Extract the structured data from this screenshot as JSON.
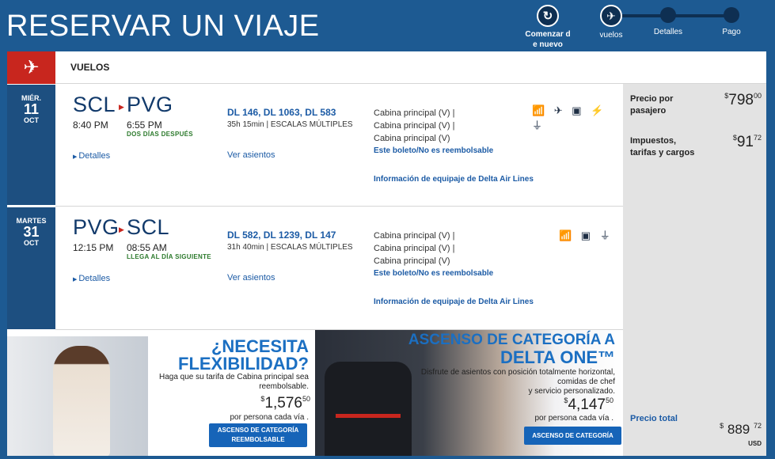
{
  "header": {
    "title": "RESERVAR UN VIAJE",
    "restart_label_1": "Comenzar d",
    "restart_label_2": "e nuevo",
    "steps": [
      {
        "label": "vuelos"
      },
      {
        "label": "Detalles"
      },
      {
        "label": "Pago"
      }
    ]
  },
  "section": {
    "title": "VUELOS"
  },
  "flights": [
    {
      "date_weekday": "MIÉR.",
      "date_day": "11",
      "date_month": "OCT",
      "origin": "SCL",
      "destination": "PVG",
      "depart_time": "8:40 PM",
      "arrive_time": "6:55 PM",
      "arrive_note": "DOS DÍAS DESPUÉS",
      "details_link": "Detalles",
      "flight_numbers": "DL 146, DL 1063, DL 583",
      "duration": "35h 15min",
      "stops": "ESCALAS MÚLTIPLES",
      "seats_link": "Ver asientos",
      "cabins": [
        "Cabina principal (V) |",
        "Cabina principal (V) |",
        "Cabina principal (V)"
      ],
      "refund": "Este boleto/No es reembolsable",
      "baggage": "Información de equipaje de Delta Air Lines",
      "amenities": "📶 ✈ ▣ ⚡ ⏚"
    },
    {
      "date_weekday": "MARTES",
      "date_day": "31",
      "date_month": "OCT",
      "origin": "PVG",
      "destination": "SCL",
      "depart_time": "12:15 PM",
      "arrive_time": "08:55 AM",
      "arrive_note": "LLEGA AL DÍA SIGUIENTE",
      "details_link": "Detalles",
      "flight_numbers": "DL 582, DL 1239, DL 147",
      "duration": "31h 40min",
      "stops": "ESCALAS MÚLTIPLES",
      "seats_link": "Ver asientos",
      "cabins": [
        "Cabina principal (V) |",
        "Cabina principal (V) |",
        "Cabina principal (V)"
      ],
      "refund": "Este boleto/No es reembolsable",
      "baggage": "Información de equipaje de Delta Air Lines",
      "amenities": "📶 ▣ ⏚"
    }
  ],
  "pricing": {
    "per_passenger_label_1": "Precio por",
    "per_passenger_label_2": "pasajero",
    "per_passenger_symbol": "$",
    "per_passenger_whole": "798",
    "per_passenger_cents": "00",
    "taxes_label_1": "Impuestos,",
    "taxes_label_2": "tarifas y cargos",
    "taxes_symbol": "$",
    "taxes_whole": "91",
    "taxes_cents": "72",
    "total_label": "Precio total",
    "total_symbol": "$",
    "total_whole": "889",
    "total_cents": "72",
    "currency": "USD"
  },
  "promo_flex": {
    "title_1": "¿NECESITA",
    "title_2": "FLEXIBILIDAD?",
    "text_1": "Haga que su tarifa de Cabina principal sea",
    "text_2": "reembolsable.",
    "price_symbol": "$",
    "price_whole": "1,576",
    "price_cents": "50",
    "per": "por persona cada vía .",
    "button_1": "ASCENSO DE CATEGORÍA",
    "button_2": "REEMBOLSABLE"
  },
  "promo_delta_one": {
    "title_1": "ASCENSO DE CATEGORÍA A",
    "title_2": "DELTA ONE™",
    "text_1": "Disfrute de asientos con posición totalmente horizontal,",
    "text_2": "comidas de chef",
    "text_3": "y servicio personalizado.",
    "price_symbol": "$",
    "price_whole": "4,147",
    "price_cents": "50",
    "per": "por persona cada vía .",
    "button": "ASCENSO DE CATEGORÍA"
  },
  "colors": {
    "header_bg": "#1d5a92",
    "accent_red": "#c8261e",
    "date_bar": "#1d4f80",
    "link_blue": "#1c5ba5",
    "promo_blue": "#1b6fc2",
    "button_blue": "#1664b8"
  }
}
